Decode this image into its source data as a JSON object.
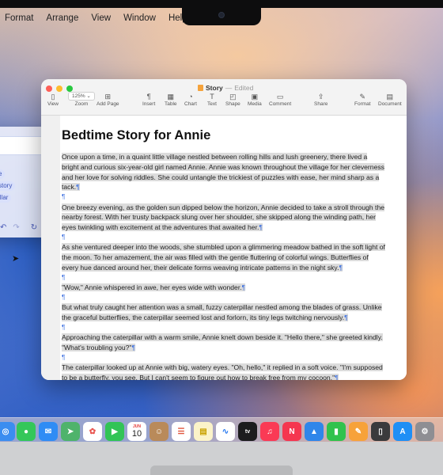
{
  "menubar": {
    "items": [
      "Format",
      "Arrange",
      "View",
      "Window",
      "Help"
    ]
  },
  "side_panel": {
    "chips": [
      "e",
      "story",
      "illar"
    ],
    "icons": [
      "undo-icon",
      "redo-icon",
      "refresh-icon",
      "add-icon"
    ]
  },
  "window": {
    "title": "Story",
    "separator": "—",
    "status": "Edited",
    "toolbar": {
      "view": "View",
      "zoom": "Zoom",
      "zoom_value": "125%",
      "add_page": "Add Page",
      "insert": "Insert",
      "table": "Table",
      "chart": "Chart",
      "text": "Text",
      "shape": "Shape",
      "media": "Media",
      "comment": "Comment",
      "share": "Share",
      "format": "Format",
      "document": "Document"
    }
  },
  "document": {
    "title": "Bedtime Story for Annie",
    "paragraphs": [
      "Once upon a time, in a quaint little village nestled between rolling hills and lush greenery, there lived a bright and curious six-year-old girl named Annie. Annie was known throughout the village for her cleverness and her love for solving riddles. She could untangle the trickiest of puzzles with ease, her mind sharp as a tack.",
      "One breezy evening, as the golden sun dipped below the horizon, Annie decided to take a stroll through the nearby forest. With her trusty backpack slung over her shoulder, she skipped along the winding path, her eyes twinkling with excitement at the adventures that awaited her.",
      "As she ventured deeper into the woods, she stumbled upon a glimmering meadow bathed in the soft light of the moon. To her amazement, the air was filled with the gentle fluttering of colorful wings. Butterflies of every hue danced around her, their delicate forms weaving intricate patterns in the night sky.",
      "\"Wow,\" Annie whispered in awe, her eyes wide with wonder.",
      "But what truly caught her attention was a small, fuzzy caterpillar nestled among the blades of grass. Unlike the graceful butterflies, the caterpillar seemed lost and forlorn, its tiny legs twitching nervously.",
      "Approaching the caterpillar with a warm smile, Annie knelt down beside it. \"Hello there,\" she greeted kindly. \"What's troubling you?\"",
      "The caterpillar looked up at Annie with big, watery eyes. \"Oh, hello,\" it replied in a soft voice. \"I'm supposed to be a butterfly, you see. But I can't seem to figure out how to break free from my cocoon.\""
    ],
    "pilcrow": "¶"
  },
  "dock": {
    "calendar_month": "JUN",
    "calendar_day": "10",
    "apps": [
      "safari",
      "messages",
      "mail",
      "maps",
      "photos",
      "facetime",
      "calendar",
      "contacts",
      "reminders",
      "notes",
      "freeform",
      "tv",
      "music",
      "news",
      "keynote",
      "numbers",
      "pages",
      "iphone-mirroring",
      "app-store",
      "system-settings"
    ]
  },
  "colors": {
    "selection": "#dcdcdc",
    "pilcrow": "#3b6fe0"
  }
}
